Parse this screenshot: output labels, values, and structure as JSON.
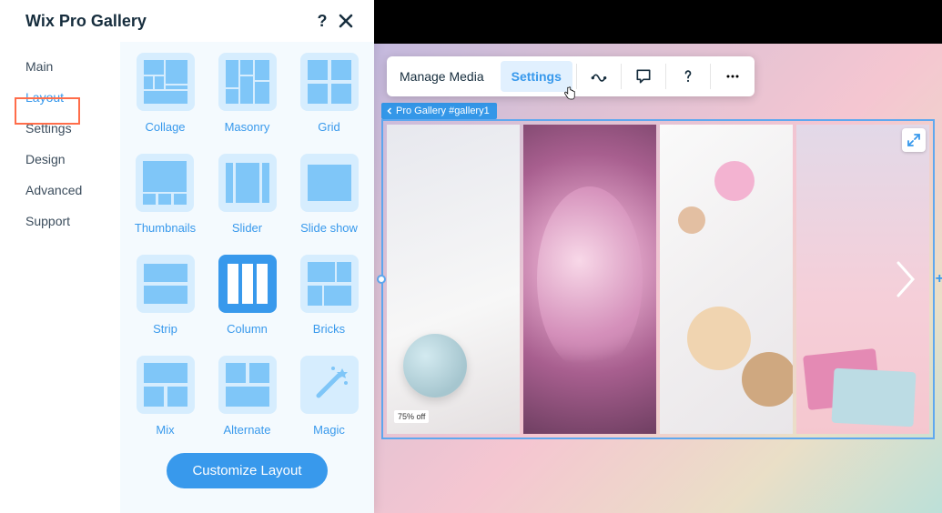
{
  "panel": {
    "title": "Wix Pro Gallery",
    "help_label": "?",
    "sidebar": [
      {
        "label": "Main"
      },
      {
        "label": "Layout",
        "active": true
      },
      {
        "label": "Settings"
      },
      {
        "label": "Design"
      },
      {
        "label": "Advanced"
      },
      {
        "label": "Support"
      }
    ],
    "layouts": [
      {
        "label": "Collage"
      },
      {
        "label": "Masonry"
      },
      {
        "label": "Grid"
      },
      {
        "label": "Thumbnails"
      },
      {
        "label": "Slider"
      },
      {
        "label": "Slide show"
      },
      {
        "label": "Strip"
      },
      {
        "label": "Column",
        "selected": true
      },
      {
        "label": "Bricks"
      },
      {
        "label": "Mix"
      },
      {
        "label": "Alternate"
      },
      {
        "label": "Magic"
      }
    ],
    "customize_button": "Customize Layout"
  },
  "toolbar": {
    "manage_media": "Manage Media",
    "settings": "Settings"
  },
  "breadcrumb": "Pro Gallery #gallery1",
  "gallery_badge": "75% off"
}
